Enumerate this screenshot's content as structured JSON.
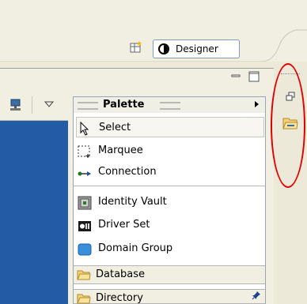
{
  "perspective": {
    "designer_label": "Designer"
  },
  "palette": {
    "title": "Palette",
    "tools": [
      {
        "label": "Select",
        "icon": "cursor-arrow-icon"
      },
      {
        "label": "Marquee",
        "icon": "marquee-icon"
      },
      {
        "label": "Connection",
        "icon": "connection-icon"
      }
    ],
    "objects": [
      {
        "label": "Identity Vault",
        "icon": "identity-vault-icon"
      },
      {
        "label": "Driver Set",
        "icon": "driver-set-icon"
      },
      {
        "label": "Domain Group",
        "icon": "domain-group-icon"
      }
    ],
    "drawers": [
      {
        "label": "Database",
        "icon": "folder-icon"
      },
      {
        "label": "Directory",
        "icon": "folder-icon"
      }
    ]
  },
  "colors": {
    "canvas": "#245ba5",
    "highlight_oval": "#e00000"
  }
}
